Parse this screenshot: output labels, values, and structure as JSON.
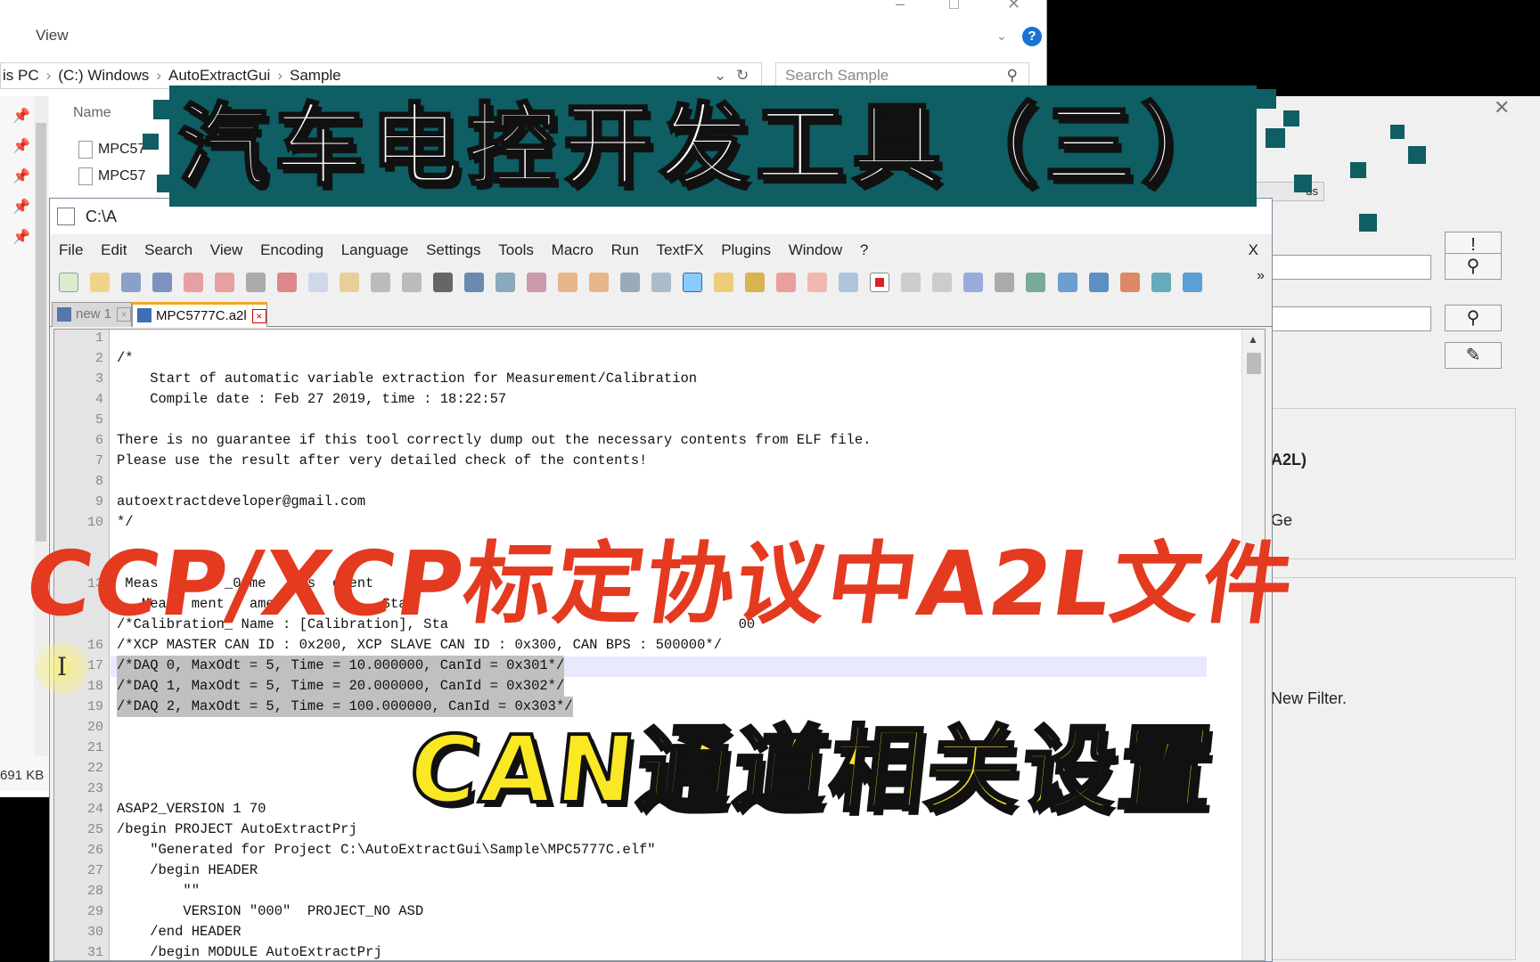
{
  "explorer": {
    "view_menu": "View",
    "address": [
      "is PC",
      "(C:) Windows",
      "AutoExtractGui",
      "Sample"
    ],
    "search_placeholder": "Search Sample",
    "column_name": "Name",
    "files": [
      "MPC57",
      "MPC57"
    ],
    "status_size": "691 KB"
  },
  "dialog": {
    "button_bang": "!",
    "label_a2l": "A2L)",
    "label_ge": "Ge",
    "label_filter": "New Filter.",
    "tab_label": "us"
  },
  "npp": {
    "title": "C:\\A",
    "menu": [
      "File",
      "Edit",
      "Search",
      "View",
      "Encoding",
      "Language",
      "Settings",
      "Tools",
      "Macro",
      "Run",
      "TextFX",
      "Plugins",
      "Window",
      "?"
    ],
    "menu_close": "X",
    "toolbar_more": "»",
    "tabs": [
      {
        "label": "new 1",
        "close": "×"
      },
      {
        "label": "MPC5777C.a2l",
        "close": "×"
      }
    ]
  },
  "code_lines": [
    {
      "n": "1",
      "text": ""
    },
    {
      "n": "2",
      "text": "/*"
    },
    {
      "n": "3",
      "text": "    Start of automatic variable extraction for Measurement/Calibration"
    },
    {
      "n": "4",
      "text": "    Compile date : Feb 27 2019, time : 18:22:57"
    },
    {
      "n": "5",
      "text": ""
    },
    {
      "n": "6",
      "text": "There is no guarantee if this tool correctly dump out the necessary contents from ELF file."
    },
    {
      "n": "7",
      "text": "Please use the result after very detailed check of the contents!"
    },
    {
      "n": "8",
      "text": ""
    },
    {
      "n": "9",
      "text": "autoextractdeveloper@gmail.com"
    },
    {
      "n": "10",
      "text": "*/"
    },
    {
      "n": "13",
      "text": " Meas        _0 me   eas  ement"
    },
    {
      "n": "",
      "text": "   Mea   ment   ame         t,  Sta"
    },
    {
      "n": "",
      "text": "/*Calibration_ Name : [Calibration], Sta                                   00"
    },
    {
      "n": "16",
      "text": "/*XCP MASTER CAN ID : 0x200, XCP SLAVE CAN ID : 0x300, CAN BPS : 500000*/"
    },
    {
      "n": "17",
      "text": "/*DAQ 0, MaxOdt = 5, Time = 10.000000, CanId = 0x301*/"
    },
    {
      "n": "18",
      "text": "/*DAQ 1, MaxOdt = 5, Time = 20.000000, CanId = 0x302*/"
    },
    {
      "n": "19",
      "text": "/*DAQ 2, MaxOdt = 5, Time = 100.000000, CanId = 0x303*/"
    },
    {
      "n": "20",
      "text": ""
    },
    {
      "n": "21",
      "text": ""
    },
    {
      "n": "22",
      "text": ""
    },
    {
      "n": "23",
      "text": ""
    },
    {
      "n": "24",
      "text": "ASAP2_VERSION 1 70"
    },
    {
      "n": "25",
      "text": "/begin PROJECT AutoExtractPrj"
    },
    {
      "n": "26",
      "text": "    \"Generated for Project C:\\AutoExtractGui\\Sample\\MPC5777C.elf\""
    },
    {
      "n": "27",
      "text": "    /begin HEADER"
    },
    {
      "n": "28",
      "text": "        \"\""
    },
    {
      "n": "29",
      "text": "        VERSION \"000\"  PROJECT_NO ASD"
    },
    {
      "n": "30",
      "text": "    /end HEADER"
    },
    {
      "n": "31",
      "text": "    /begin MODULE AutoExtractPrj"
    }
  ],
  "overlay": {
    "title": "汽车电控开发工具（三）",
    "subtitle1": "CCP/XCP标定协议中A2L文件",
    "subtitle2": "CAN通道相关设置"
  },
  "colors": {
    "banner_teal": "#0e5e63",
    "subtitle_red": "#e43a20",
    "subtitle_yellow": "#fbe825"
  }
}
